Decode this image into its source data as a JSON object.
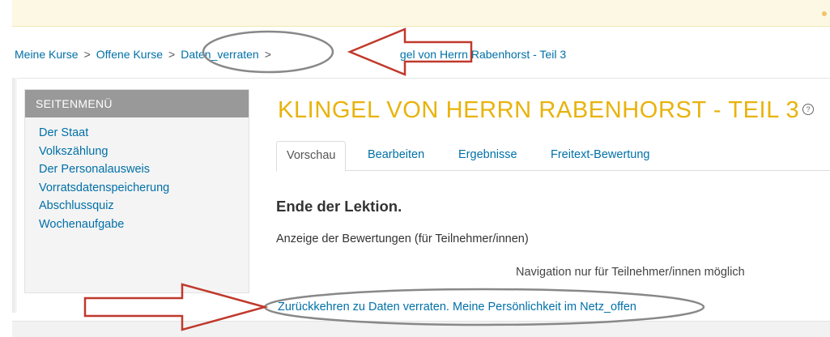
{
  "breadcrumb": {
    "items": [
      "Meine Kurse",
      "Offene Kurse",
      "Daten_verraten"
    ],
    "current_visible": "gel von Herrn Rabenhorst - Teil 3",
    "separator": ">"
  },
  "sidebar": {
    "title": "SEITENMENÜ",
    "items": [
      {
        "label": "Der Staat"
      },
      {
        "label": "Volkszählung"
      },
      {
        "label": "Der Personalausweis"
      },
      {
        "label": "Vorratsdatenspeicherung"
      },
      {
        "label": "Abschlussquiz"
      },
      {
        "label": "Wochenaufgabe"
      }
    ]
  },
  "main": {
    "title": "KLINGEL VON HERRN RABENHORST - TEIL 3",
    "help_icon": "?",
    "tabs": [
      {
        "label": "Vorschau",
        "active": true
      },
      {
        "label": "Bearbeiten"
      },
      {
        "label": "Ergebnisse"
      },
      {
        "label": "Freitext-Bewertung"
      }
    ],
    "heading": "Ende der Lektion.",
    "score_text": "Anzeige der Bewertungen (für Teilnehmer/innen)",
    "nav_note": "Navigation nur für Teilnehmer/innen möglich",
    "return_link": "Zurückkehren zu Daten verraten. Meine Persönlichkeit im Netz_offen"
  },
  "colors": {
    "link": "#0070a8",
    "title": "#e8b30c",
    "sidebar_header": "#999999",
    "annotation_red": "#c0392b"
  }
}
